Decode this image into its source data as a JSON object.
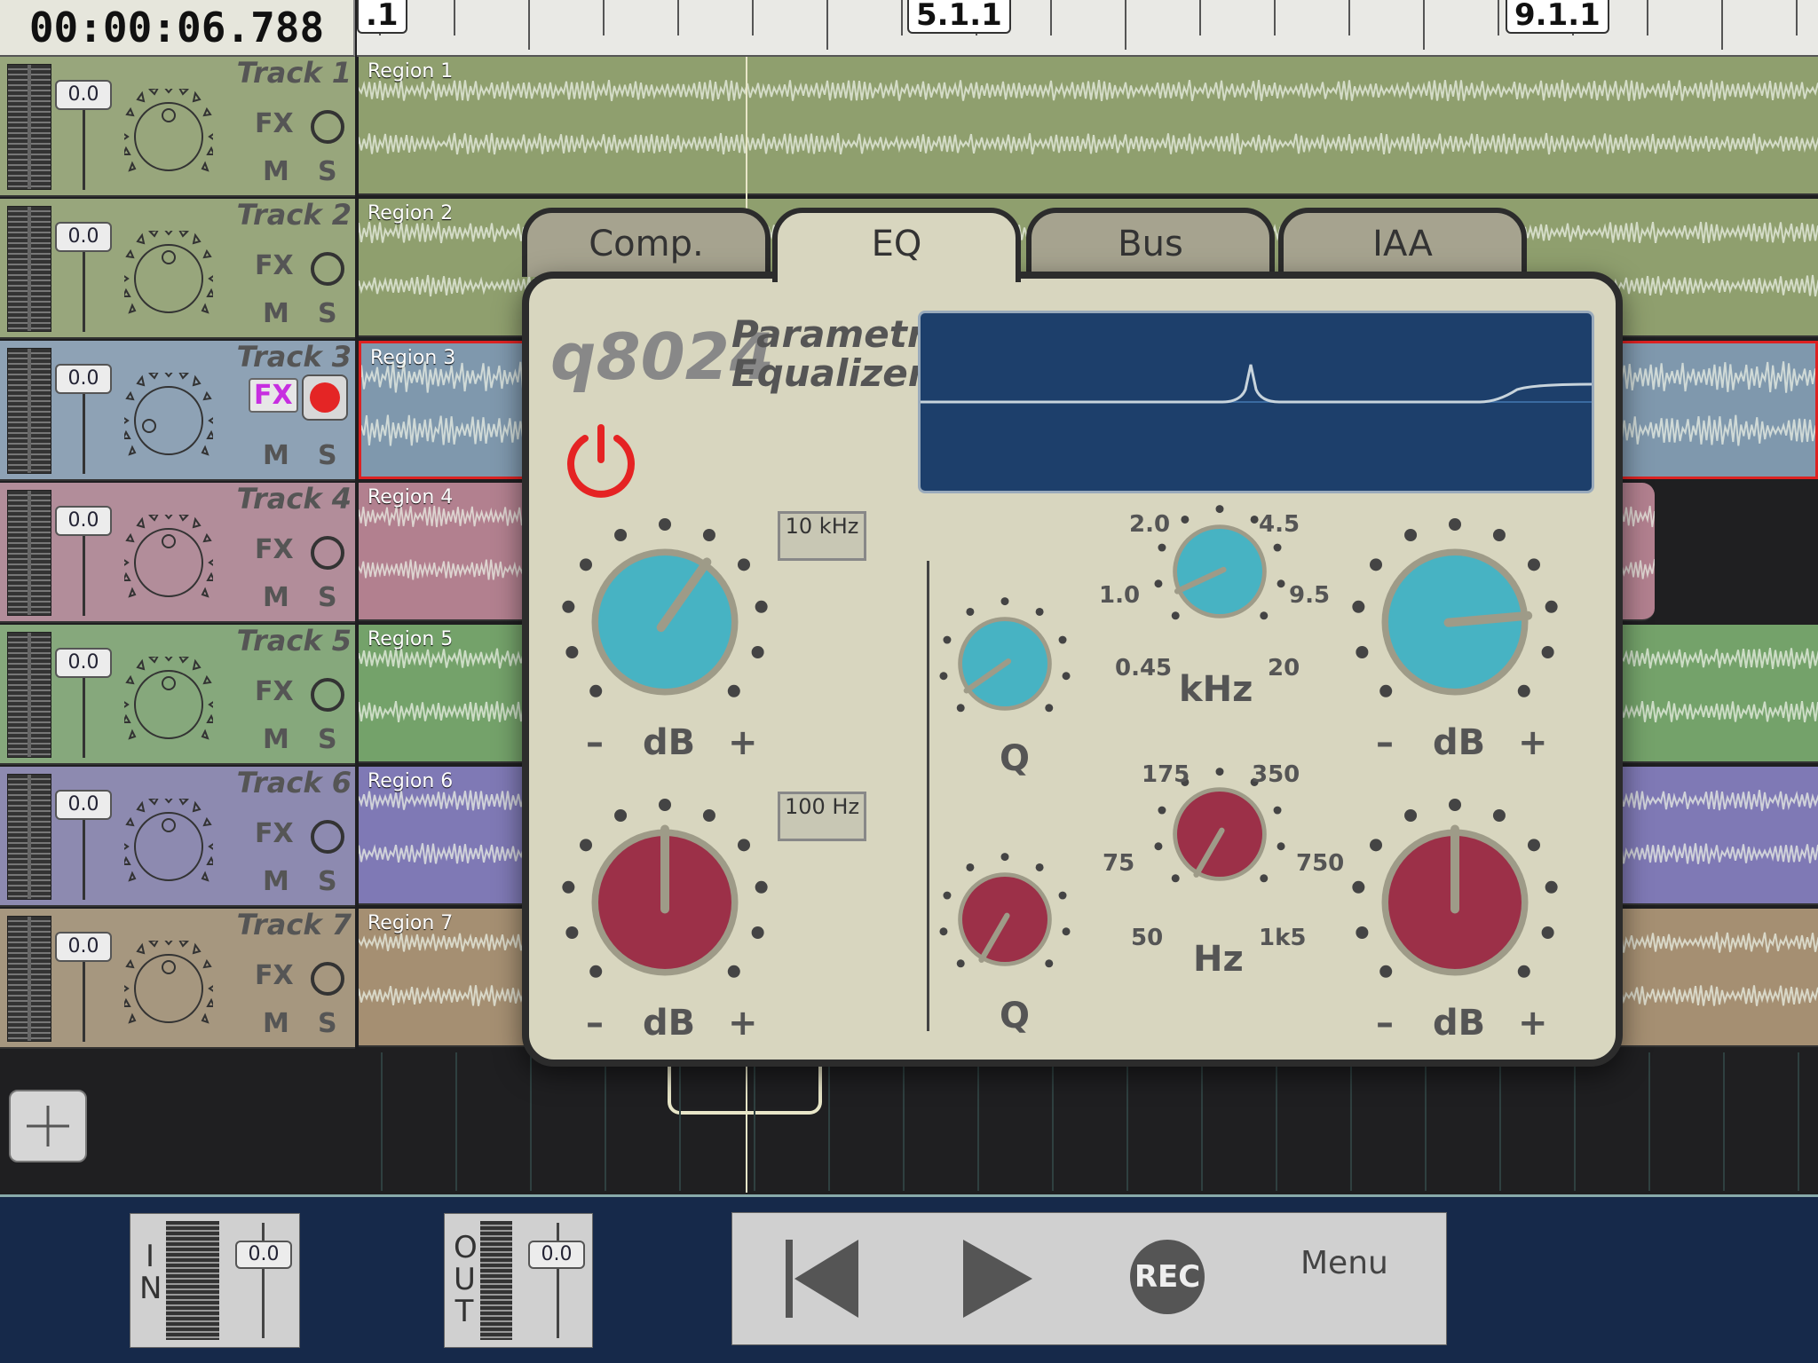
{
  "timecode": "00:00:06.788",
  "ruler": {
    "labels": [
      ".1",
      "5.1.1",
      "9.1.1"
    ]
  },
  "tracks": [
    {
      "name": "Track 1",
      "fader": "0.0",
      "fx": "FX",
      "mute": "M",
      "solo": "S",
      "region": "Region 1",
      "color": "#98a67c",
      "region_color": "#8f9f6e",
      "armed": false,
      "selected": false
    },
    {
      "name": "Track 2",
      "fader": "0.0",
      "fx": "FX",
      "mute": "M",
      "solo": "S",
      "region": "Region 2",
      "color": "#98a67c",
      "region_color": "#8f9f6e",
      "armed": false,
      "selected": false
    },
    {
      "name": "Track 3",
      "fader": "0.0",
      "fx": "FX",
      "mute": "M",
      "solo": "S",
      "region": "Region 3",
      "color": "#8ea2b5",
      "region_color": "#7f98ad",
      "armed": true,
      "selected": true
    },
    {
      "name": "Track 4",
      "fader": "0.0",
      "fx": "FX",
      "mute": "M",
      "solo": "S",
      "region": "Region 4",
      "color": "#b28d9a",
      "region_color": "#b2808f",
      "armed": false,
      "selected": false
    },
    {
      "name": "Track 5",
      "fader": "0.0",
      "fx": "FX",
      "mute": "M",
      "solo": "S",
      "region": "Region 5",
      "color": "#86a87c",
      "region_color": "#74a26a",
      "armed": false,
      "selected": false
    },
    {
      "name": "Track 6",
      "fader": "0.0",
      "fx": "FX",
      "mute": "M",
      "solo": "S",
      "region": "Region 6",
      "color": "#8d8ab0",
      "region_color": "#7f79b5",
      "armed": false,
      "selected": false
    },
    {
      "name": "Track 7",
      "fader": "0.0",
      "fx": "FX",
      "mute": "M",
      "solo": "S",
      "region": "Region 7",
      "color": "#a6977f",
      "region_color": "#a58f72",
      "armed": false,
      "selected": false
    }
  ],
  "eq": {
    "tabs": [
      "Comp.",
      "EQ",
      "Bus",
      "IAA"
    ],
    "active_tab": "EQ",
    "brand": "q8024",
    "title_line1": "Parametric",
    "title_line2": "Equalizer",
    "high_shelf_freq": "10 kHz",
    "low_shelf_freq": "100 Hz",
    "db_label": "dB",
    "minus": "–",
    "plus": "+",
    "q_label": "Q",
    "khz_label": "kHz",
    "hz_label": "Hz",
    "khz_scale": [
      "2.0",
      "4.5",
      "1.0",
      "9.5",
      "0.45",
      "20"
    ],
    "hz_scale": [
      "175",
      "350",
      "75",
      "750",
      "50",
      "1k5"
    ],
    "power_color": "#e52323",
    "teal": "#47b3c3",
    "red": "#9c3048"
  },
  "bottom": {
    "in_label": "IN",
    "out_label": "OUT",
    "in_value": "0.0",
    "out_value": "0.0",
    "rec": "REC",
    "menu": "Menu"
  }
}
